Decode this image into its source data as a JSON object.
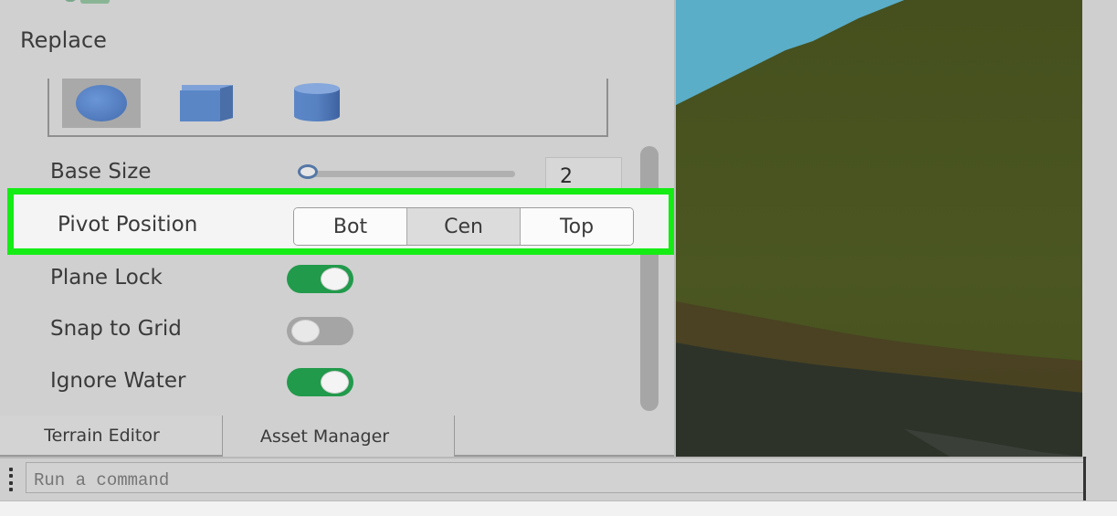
{
  "panel": {
    "section_title": "Replace",
    "shapes": [
      {
        "name": "Sphere",
        "icon": "sphere-icon",
        "selected": true
      },
      {
        "name": "Cube",
        "icon": "cube-icon",
        "selected": false
      },
      {
        "name": "Cylinder",
        "icon": "cylinder-icon",
        "selected": false
      }
    ],
    "base_size": {
      "label": "Base Size",
      "value": "2",
      "slider_fraction": 0.02
    },
    "pivot_position": {
      "label": "Pivot Position",
      "options": [
        "Bot",
        "Cen",
        "Top"
      ],
      "selected": "Cen"
    },
    "toggles": [
      {
        "label": "Plane Lock",
        "on": true
      },
      {
        "label": "Snap to Grid",
        "on": false
      },
      {
        "label": "Ignore Water",
        "on": true
      }
    ],
    "tabs": [
      {
        "label": "Terrain Editor",
        "active": true
      },
      {
        "label": "Asset Manager",
        "active": false
      }
    ]
  },
  "command_bar": {
    "placeholder": "Run a command"
  },
  "colors": {
    "highlight": "#14ec14",
    "toggle_on": "#219a4b",
    "toggle_off": "#a5a5a5",
    "shape_blue": "#5a86c6",
    "sky": "#5aaec8",
    "grass": "#46511f"
  }
}
